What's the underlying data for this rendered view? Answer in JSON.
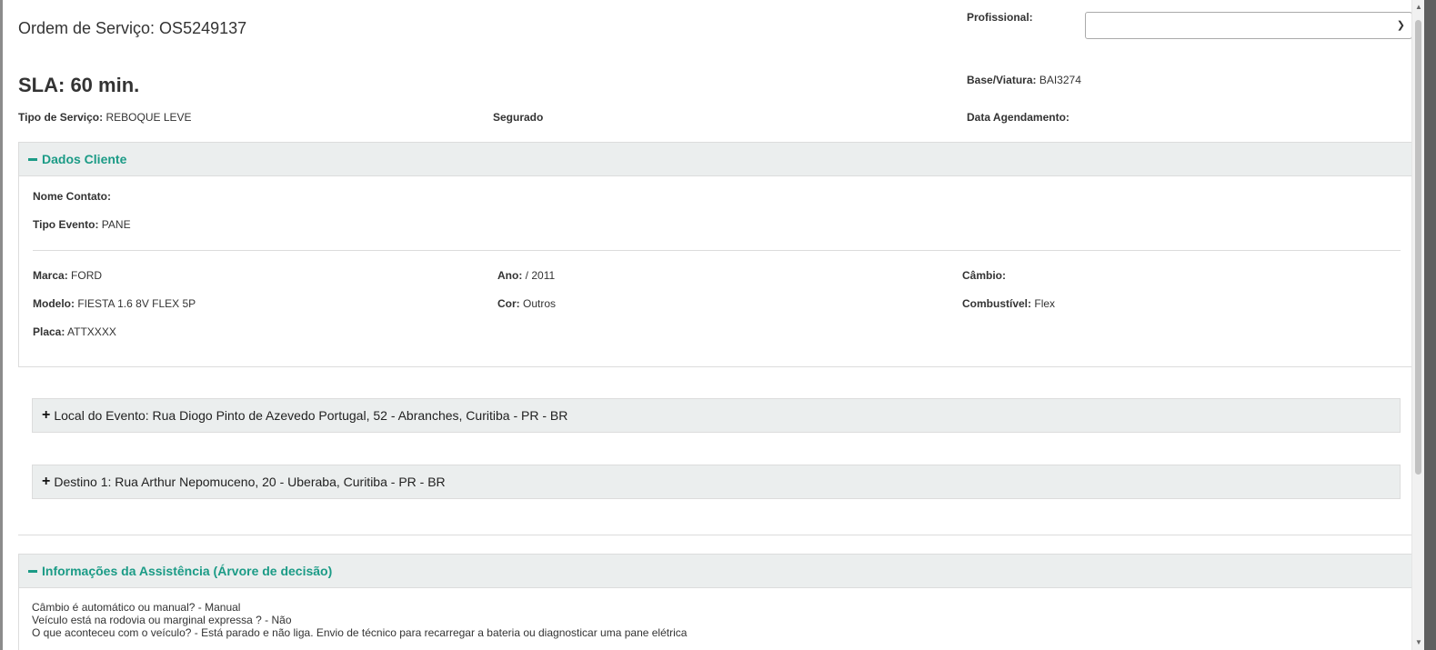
{
  "header": {
    "title": "Ordem de Serviço: OS5249137",
    "sla": "SLA: 60 min.",
    "profissional_label": "Profissional:",
    "profissional_value": "",
    "base_label": "Base/Viatura:",
    "base_value": "BAI3274"
  },
  "summary": {
    "tipo_servico_label": "Tipo de Serviço:",
    "tipo_servico_value": "REBOQUE LEVE",
    "segurado_label": "Segurado",
    "data_agendamento_label": "Data Agendamento:"
  },
  "dados_cliente": {
    "header": "Dados Cliente",
    "nome_contato_label": "Nome Contato:",
    "tipo_evento_label": "Tipo Evento:",
    "tipo_evento_value": "PANE",
    "marca_label": "Marca:",
    "marca_value": "FORD",
    "ano_label": "Ano:",
    "ano_value": "/ 2011",
    "cambio_label": "Câmbio:",
    "modelo_label": "Modelo:",
    "modelo_value": "FIESTA 1.6 8V FLEX 5P",
    "cor_label": "Cor:",
    "cor_value": "Outros",
    "combustivel_label": "Combustível:",
    "combustivel_value": "Flex",
    "placa_label": "Placa:",
    "placa_value": "ATTXXXX"
  },
  "local_evento": "Local do Evento: Rua Diogo Pinto de Azevedo Portugal, 52 - Abranches, Curitiba - PR - BR",
  "destino": "Destino 1: Rua Arthur Nepomuceno, 20 - Uberaba, Curitiba - PR - BR",
  "assistencia": {
    "header": "Informações da Assistência (Árvore de decisão)",
    "lines": [
      "Câmbio é automático ou manual? - Manual",
      "Veículo está na rodovia ou marginal expressa ? - Não",
      "O que aconteceu com o veículo? - Está parado e não liga. Envio de técnico para recarregar a bateria ou diagnosticar uma pane elétrica"
    ]
  },
  "colors": {
    "accent": "#1b9b86",
    "panel_bg": "#ebeeee"
  }
}
